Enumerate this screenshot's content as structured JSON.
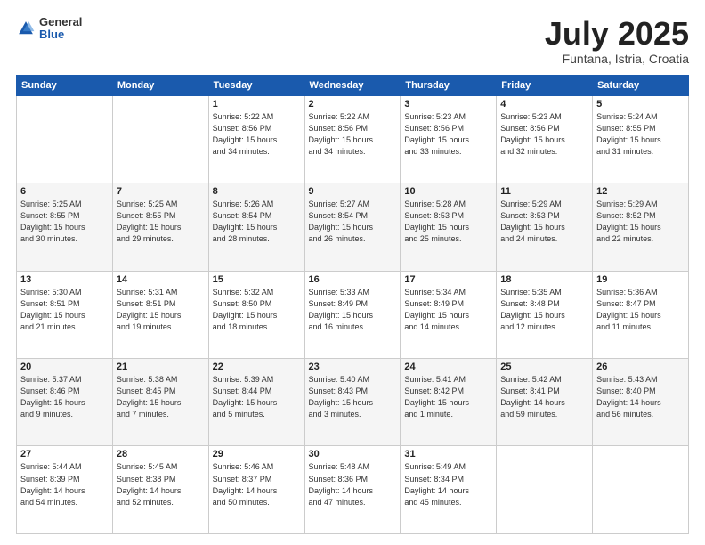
{
  "header": {
    "logo": {
      "general": "General",
      "blue": "Blue"
    },
    "title": "July 2025",
    "location": "Funtana, Istria, Croatia"
  },
  "weekdays": [
    "Sunday",
    "Monday",
    "Tuesday",
    "Wednesday",
    "Thursday",
    "Friday",
    "Saturday"
  ],
  "weeks": [
    [
      {
        "day": "",
        "lines": []
      },
      {
        "day": "",
        "lines": []
      },
      {
        "day": "1",
        "lines": [
          "Sunrise: 5:22 AM",
          "Sunset: 8:56 PM",
          "Daylight: 15 hours",
          "and 34 minutes."
        ]
      },
      {
        "day": "2",
        "lines": [
          "Sunrise: 5:22 AM",
          "Sunset: 8:56 PM",
          "Daylight: 15 hours",
          "and 34 minutes."
        ]
      },
      {
        "day": "3",
        "lines": [
          "Sunrise: 5:23 AM",
          "Sunset: 8:56 PM",
          "Daylight: 15 hours",
          "and 33 minutes."
        ]
      },
      {
        "day": "4",
        "lines": [
          "Sunrise: 5:23 AM",
          "Sunset: 8:56 PM",
          "Daylight: 15 hours",
          "and 32 minutes."
        ]
      },
      {
        "day": "5",
        "lines": [
          "Sunrise: 5:24 AM",
          "Sunset: 8:55 PM",
          "Daylight: 15 hours",
          "and 31 minutes."
        ]
      }
    ],
    [
      {
        "day": "6",
        "lines": [
          "Sunrise: 5:25 AM",
          "Sunset: 8:55 PM",
          "Daylight: 15 hours",
          "and 30 minutes."
        ]
      },
      {
        "day": "7",
        "lines": [
          "Sunrise: 5:25 AM",
          "Sunset: 8:55 PM",
          "Daylight: 15 hours",
          "and 29 minutes."
        ]
      },
      {
        "day": "8",
        "lines": [
          "Sunrise: 5:26 AM",
          "Sunset: 8:54 PM",
          "Daylight: 15 hours",
          "and 28 minutes."
        ]
      },
      {
        "day": "9",
        "lines": [
          "Sunrise: 5:27 AM",
          "Sunset: 8:54 PM",
          "Daylight: 15 hours",
          "and 26 minutes."
        ]
      },
      {
        "day": "10",
        "lines": [
          "Sunrise: 5:28 AM",
          "Sunset: 8:53 PM",
          "Daylight: 15 hours",
          "and 25 minutes."
        ]
      },
      {
        "day": "11",
        "lines": [
          "Sunrise: 5:29 AM",
          "Sunset: 8:53 PM",
          "Daylight: 15 hours",
          "and 24 minutes."
        ]
      },
      {
        "day": "12",
        "lines": [
          "Sunrise: 5:29 AM",
          "Sunset: 8:52 PM",
          "Daylight: 15 hours",
          "and 22 minutes."
        ]
      }
    ],
    [
      {
        "day": "13",
        "lines": [
          "Sunrise: 5:30 AM",
          "Sunset: 8:51 PM",
          "Daylight: 15 hours",
          "and 21 minutes."
        ]
      },
      {
        "day": "14",
        "lines": [
          "Sunrise: 5:31 AM",
          "Sunset: 8:51 PM",
          "Daylight: 15 hours",
          "and 19 minutes."
        ]
      },
      {
        "day": "15",
        "lines": [
          "Sunrise: 5:32 AM",
          "Sunset: 8:50 PM",
          "Daylight: 15 hours",
          "and 18 minutes."
        ]
      },
      {
        "day": "16",
        "lines": [
          "Sunrise: 5:33 AM",
          "Sunset: 8:49 PM",
          "Daylight: 15 hours",
          "and 16 minutes."
        ]
      },
      {
        "day": "17",
        "lines": [
          "Sunrise: 5:34 AM",
          "Sunset: 8:49 PM",
          "Daylight: 15 hours",
          "and 14 minutes."
        ]
      },
      {
        "day": "18",
        "lines": [
          "Sunrise: 5:35 AM",
          "Sunset: 8:48 PM",
          "Daylight: 15 hours",
          "and 12 minutes."
        ]
      },
      {
        "day": "19",
        "lines": [
          "Sunrise: 5:36 AM",
          "Sunset: 8:47 PM",
          "Daylight: 15 hours",
          "and 11 minutes."
        ]
      }
    ],
    [
      {
        "day": "20",
        "lines": [
          "Sunrise: 5:37 AM",
          "Sunset: 8:46 PM",
          "Daylight: 15 hours",
          "and 9 minutes."
        ]
      },
      {
        "day": "21",
        "lines": [
          "Sunrise: 5:38 AM",
          "Sunset: 8:45 PM",
          "Daylight: 15 hours",
          "and 7 minutes."
        ]
      },
      {
        "day": "22",
        "lines": [
          "Sunrise: 5:39 AM",
          "Sunset: 8:44 PM",
          "Daylight: 15 hours",
          "and 5 minutes."
        ]
      },
      {
        "day": "23",
        "lines": [
          "Sunrise: 5:40 AM",
          "Sunset: 8:43 PM",
          "Daylight: 15 hours",
          "and 3 minutes."
        ]
      },
      {
        "day": "24",
        "lines": [
          "Sunrise: 5:41 AM",
          "Sunset: 8:42 PM",
          "Daylight: 15 hours",
          "and 1 minute."
        ]
      },
      {
        "day": "25",
        "lines": [
          "Sunrise: 5:42 AM",
          "Sunset: 8:41 PM",
          "Daylight: 14 hours",
          "and 59 minutes."
        ]
      },
      {
        "day": "26",
        "lines": [
          "Sunrise: 5:43 AM",
          "Sunset: 8:40 PM",
          "Daylight: 14 hours",
          "and 56 minutes."
        ]
      }
    ],
    [
      {
        "day": "27",
        "lines": [
          "Sunrise: 5:44 AM",
          "Sunset: 8:39 PM",
          "Daylight: 14 hours",
          "and 54 minutes."
        ]
      },
      {
        "day": "28",
        "lines": [
          "Sunrise: 5:45 AM",
          "Sunset: 8:38 PM",
          "Daylight: 14 hours",
          "and 52 minutes."
        ]
      },
      {
        "day": "29",
        "lines": [
          "Sunrise: 5:46 AM",
          "Sunset: 8:37 PM",
          "Daylight: 14 hours",
          "and 50 minutes."
        ]
      },
      {
        "day": "30",
        "lines": [
          "Sunrise: 5:48 AM",
          "Sunset: 8:36 PM",
          "Daylight: 14 hours",
          "and 47 minutes."
        ]
      },
      {
        "day": "31",
        "lines": [
          "Sunrise: 5:49 AM",
          "Sunset: 8:34 PM",
          "Daylight: 14 hours",
          "and 45 minutes."
        ]
      },
      {
        "day": "",
        "lines": []
      },
      {
        "day": "",
        "lines": []
      }
    ]
  ]
}
